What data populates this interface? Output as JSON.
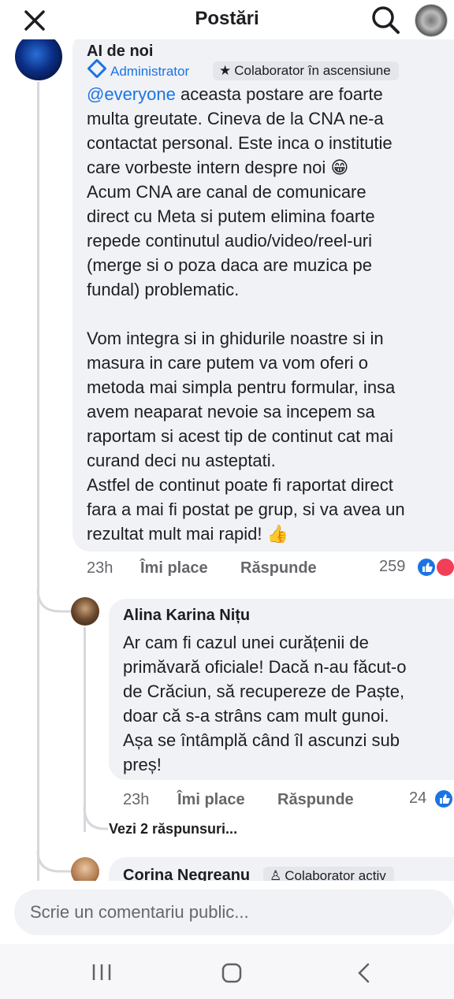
{
  "header": {
    "title": "Postări",
    "close_icon": "close-icon",
    "search_icon": "search-icon"
  },
  "main_comment": {
    "author": "AI de noi",
    "admin_badge": "Administrator",
    "collab_badge": "Colaborator în ascensiune",
    "mention": "@everyone",
    "lines": [
      " aceasta postare are foarte",
      "multa greutate. Cineva de la CNA ne-a",
      "contactat personal. Este inca o institutie",
      "care vorbeste intern despre noi 😁",
      "Acum CNA are canal de comunicare",
      "direct cu Meta si putem elimina foarte",
      "repede continutul audio/video/reel-uri",
      "(merge si o poza daca are muzica pe",
      "fundal) problematic.",
      "",
      "Vom integra si in ghidurile noastre si in",
      "masura in care putem va vom oferi o",
      "metoda mai simpla pentru formular, insa",
      "avem neaparat nevoie sa incepem sa",
      "raportam si acest tip de continut cat mai",
      "curand deci nu asteptati.",
      "Astfel de continut poate fi raportat direct",
      "fara a mai fi postat pe grup, si va avea un",
      "rezultat mult mai rapid! 👍"
    ],
    "time": "23h",
    "like_label": "Îmi place",
    "reply_label": "Răspunde",
    "reactions": "259"
  },
  "reply": {
    "author": "Alina Karina Nițu",
    "lines": [
      "Ar cam fi cazul unei curățenii de",
      "primăvară oficiale! Dacă n-au făcut-o",
      "de Crăciun, să recupereze de Paște,",
      "doar că s-a strâns cam mult gunoi.",
      "Așa se întâmplă când îl ascunzi sub",
      "preș!"
    ],
    "time": "23h",
    "like_label": "Îmi place",
    "reply_label": "Răspunde",
    "reactions": "24"
  },
  "more_replies": "Vezi 2 răspunsuri...",
  "third_comment": {
    "author": "Corina Negreanu",
    "badge": "Colaborator activ"
  },
  "composer": {
    "placeholder": "Scrie un comentariu public..."
  },
  "colors": {
    "accent": "#1b74e4",
    "love": "#f33e58",
    "bubble": "#f0f2f5"
  }
}
